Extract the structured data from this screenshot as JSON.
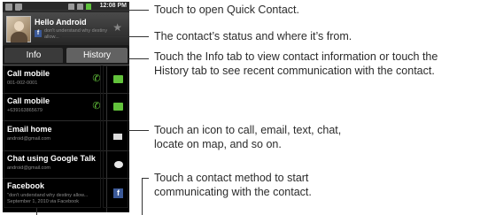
{
  "status_bar": {
    "time": "12:08 PM"
  },
  "contact_header": {
    "name": "Hello Android",
    "status_text": "don't understand why destiny allow...",
    "status_source_icon": "facebook-icon",
    "favorite_icon": "star-icon"
  },
  "tabs": [
    {
      "label": "Info"
    },
    {
      "label": "History"
    }
  ],
  "methods": [
    {
      "title": "Call mobile",
      "detail": "001-002-0001",
      "action_icon": "phone-call-icon",
      "secondary_icon": "message-icon"
    },
    {
      "title": "Call mobile",
      "detail": "+639163865679",
      "action_icon": "phone-call-icon",
      "secondary_icon": "message-icon"
    },
    {
      "title": "Email home",
      "detail": "android@gmail.com",
      "action_icon": "email-icon"
    },
    {
      "title": "Chat using Google Talk",
      "detail": "android@gmail.com",
      "action_icon": "chat-icon"
    },
    {
      "title": "Facebook",
      "detail": "\"don't understand why destiny allow...",
      "detail2": "September 1, 2010 via Facebook",
      "action_icon": "facebook-icon"
    }
  ],
  "callouts": [
    {
      "text": "Touch to open Quick Contact."
    },
    {
      "text": "The contact’s status and where it’s from."
    },
    {
      "line1": "Touch the Info tab to view contact information or touch the",
      "line2": "History tab to see recent communication with the contact."
    },
    {
      "line1": "Touch an icon to call, email, text, chat,",
      "line2": "locate on map, and so on."
    },
    {
      "line1": "Touch a contact method to start",
      "line2": "communicating with the contact."
    }
  ]
}
